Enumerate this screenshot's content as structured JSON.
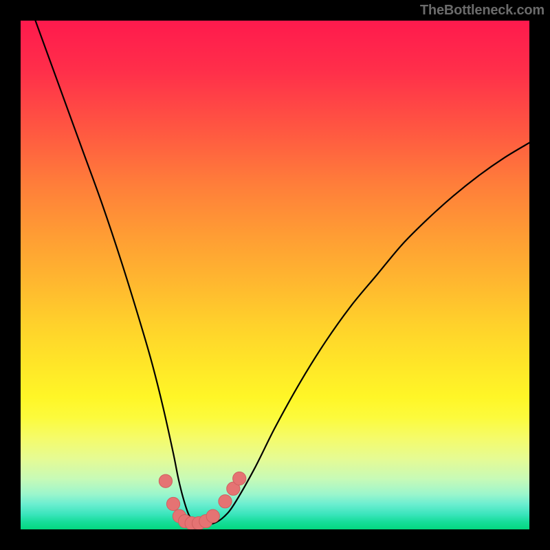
{
  "watermark": "TheBottleneck.com",
  "colors": {
    "frame": "#000000",
    "curve": "#000000",
    "marker_fill": "#e57373",
    "marker_stroke": "#cf6060"
  },
  "chart_data": {
    "type": "line",
    "title": "",
    "xlabel": "",
    "ylabel": "",
    "xlim": [
      0,
      100
    ],
    "ylim": [
      0,
      100
    ],
    "grid": false,
    "series": [
      {
        "name": "curve",
        "x": [
          0,
          4,
          8,
          12,
          16,
          20,
          24,
          26,
          28,
          30,
          31,
          32,
          33,
          34,
          35,
          36,
          38,
          40,
          42,
          46,
          50,
          55,
          60,
          65,
          70,
          75,
          80,
          85,
          90,
          95,
          100
        ],
        "y": [
          108,
          97,
          86,
          75,
          64,
          52,
          39,
          32,
          24,
          15,
          10,
          6,
          3,
          1.5,
          1,
          1,
          1.2,
          2.5,
          5,
          12,
          20,
          29,
          37,
          44,
          50,
          56,
          61,
          65.5,
          69.5,
          73,
          76
        ]
      }
    ],
    "markers": [
      {
        "x": 28.5,
        "y": 9.5,
        "r": 1.3
      },
      {
        "x": 30.0,
        "y": 5.0,
        "r": 1.3
      },
      {
        "x": 31.2,
        "y": 2.6,
        "r": 1.3
      },
      {
        "x": 32.3,
        "y": 1.6,
        "r": 1.3
      },
      {
        "x": 33.6,
        "y": 1.2,
        "r": 1.3
      },
      {
        "x": 35.0,
        "y": 1.2,
        "r": 1.3
      },
      {
        "x": 36.4,
        "y": 1.6,
        "r": 1.3
      },
      {
        "x": 37.8,
        "y": 2.6,
        "r": 1.3
      },
      {
        "x": 40.2,
        "y": 5.5,
        "r": 1.3
      },
      {
        "x": 41.8,
        "y": 8.0,
        "r": 1.3
      },
      {
        "x": 43.0,
        "y": 10.0,
        "r": 1.3
      }
    ]
  }
}
